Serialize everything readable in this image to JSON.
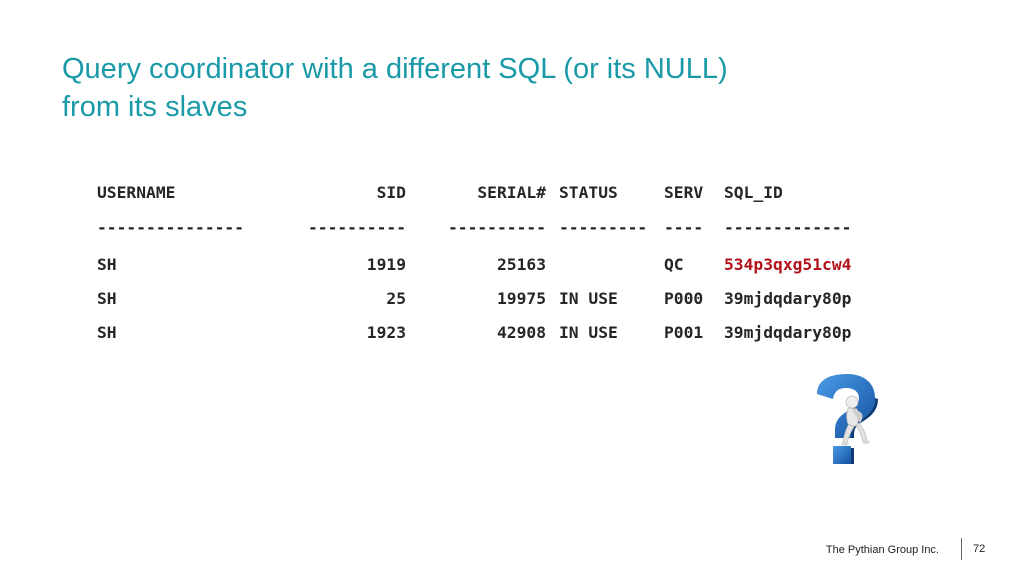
{
  "slide": {
    "title_line1": "Query coordinator with a different SQL (or its NULL)",
    "title_line2": "from its slaves"
  },
  "sql_output": {
    "headers": {
      "username": "USERNAME",
      "sid": "SID",
      "serial": "SERIAL#",
      "status": "STATUS",
      "serv": "SERV",
      "sql_id": "SQL_ID"
    },
    "separators": {
      "username": "---------------",
      "sid": "----------",
      "serial": "----------",
      "status": "---------",
      "serv": "----",
      "sql_id": "-------------"
    },
    "rows": [
      {
        "username": "SH",
        "sid": "1919",
        "serial": "25163",
        "status": "",
        "serv": "QC",
        "sql_id": "534p3qxg51cw4"
      },
      {
        "username": "SH",
        "sid": "25",
        "serial": "19975",
        "status": "IN USE",
        "serv": "P000",
        "sql_id": "39mjdqdary80p"
      },
      {
        "username": "SH",
        "sid": "1923",
        "serial": "42908",
        "status": "IN USE",
        "serv": "P001",
        "sql_id": "39mjdqdary80p"
      }
    ],
    "highlight_color": "#b3121a"
  },
  "illustration": {
    "icon": "question-mark-thinker-icon",
    "colors": {
      "question_mark": "#1f6fc4",
      "figure": "#e8e8e8"
    }
  },
  "footer": {
    "company": "The Pythian Group Inc.",
    "page_number": "72"
  },
  "theme": {
    "title_color": "#1a9aa8",
    "text_color": "#262626"
  }
}
